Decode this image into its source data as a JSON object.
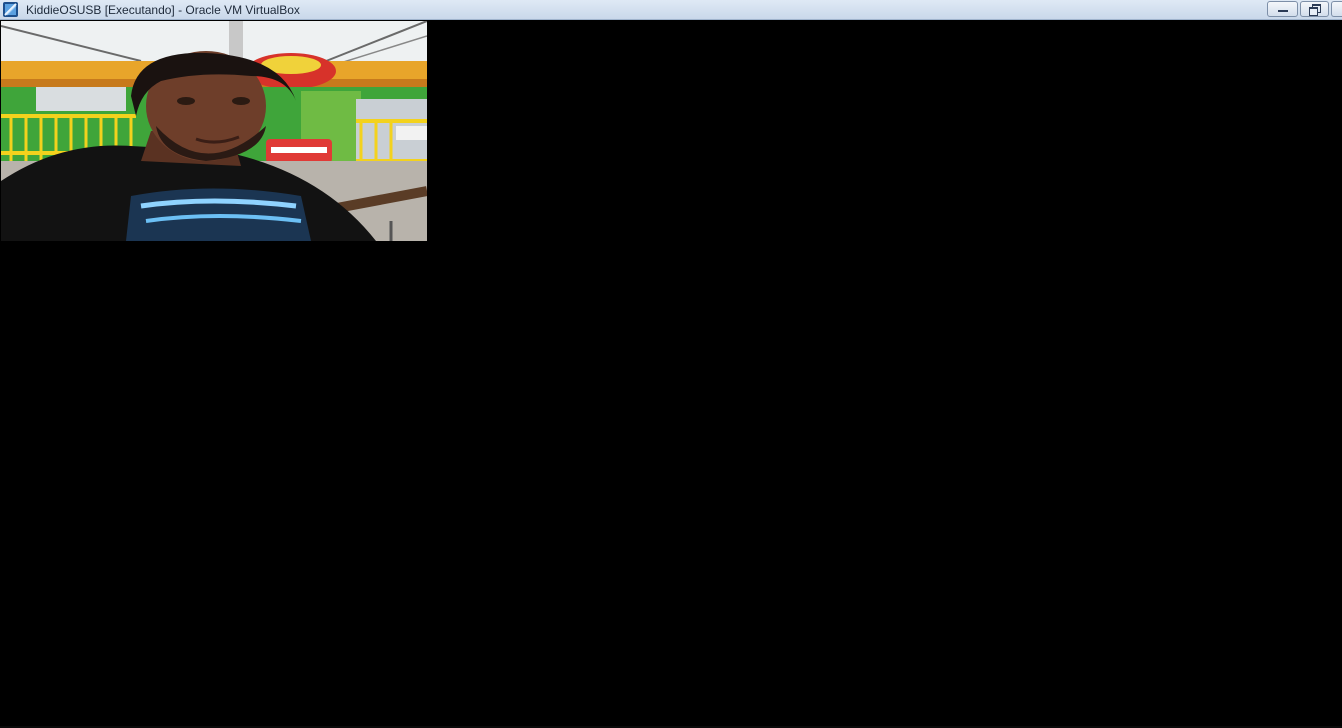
{
  "window": {
    "title": "KiddieOSUSB [Executando] - Oracle VM VirtualBox",
    "app_icon": "virtualbox-icon",
    "controls": {
      "minimize_icon": "minimize-icon",
      "restore_icon": "restore-icon",
      "close_icon": "close-icon"
    }
  },
  "vm_screen": {
    "background_color": "#000000",
    "image": "photo of a man in a black t-shirt at an amusement park ride"
  }
}
